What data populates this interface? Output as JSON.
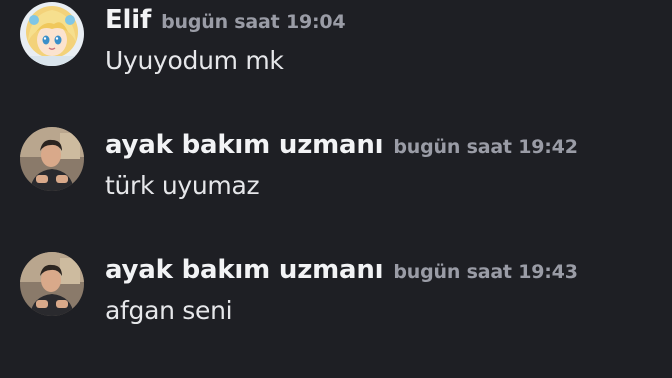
{
  "messages": [
    {
      "author": "Elif",
      "timestamp": "bugün saat 19:04",
      "text": "Uyuyodum mk",
      "avatar_icon": "anime-girl-avatar-icon"
    },
    {
      "author": "ayak bakım uzmanı",
      "timestamp": "bugün saat 19:42",
      "text": "türk uyumaz",
      "avatar_icon": "man-photo-avatar-icon"
    },
    {
      "author": "ayak bakım uzmanı",
      "timestamp": "bugün saat 19:43",
      "text": "afgan seni",
      "avatar_icon": "man-photo-avatar-icon"
    }
  ],
  "colors": {
    "background": "#1e1f24",
    "username": "#f2f3f5",
    "timestamp": "#9a9ca6",
    "message_text": "#e6e7ea"
  }
}
